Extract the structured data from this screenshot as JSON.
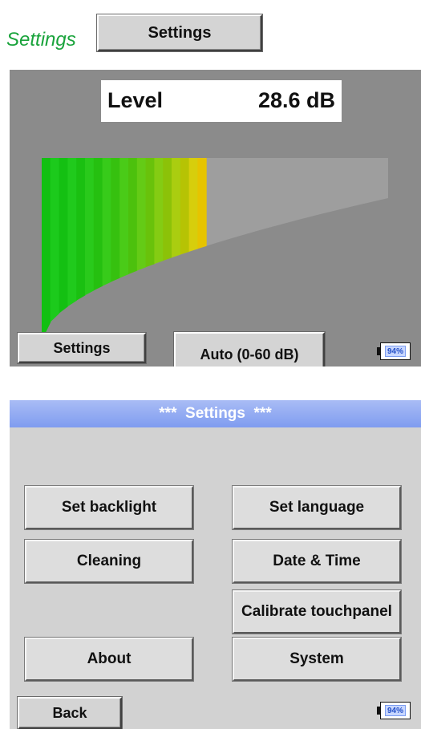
{
  "header": {
    "heading": "Settings",
    "button_label": "Settings"
  },
  "screen1": {
    "level_label": "Level",
    "level_value": "28.6 dB",
    "level_db": 28.6,
    "range_max_db": 60,
    "colors": {
      "gauge_bg": "#9e9e9e",
      "green": "#12c012",
      "yellow": "#e6c400",
      "panel_bg": "#8b8b8b"
    },
    "settings_button": "Settings",
    "range_button": "Auto (0-60 dB)",
    "battery": "94%"
  },
  "screen2": {
    "title": "***  Settings  ***",
    "buttons": {
      "set_backlight": "Set backlight",
      "set_language": "Set language",
      "cleaning": "Cleaning",
      "date_time": "Date & Time",
      "calibrate_touchpanel": "Calibrate touchpanel",
      "about": "About",
      "system": "System"
    },
    "back_button": "Back",
    "battery": "94%",
    "colors": {
      "title_bar": "#8fa8f2",
      "panel_bg": "#d2d2d2"
    }
  }
}
